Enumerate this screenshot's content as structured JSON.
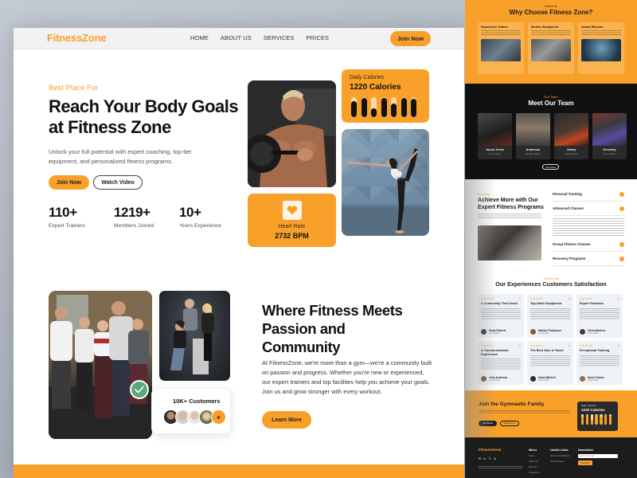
{
  "nav": {
    "logo": "FitnessZone",
    "links": [
      "HOME",
      "ABOUT US",
      "SERVICES",
      "PRICES"
    ],
    "cta": "Join Now"
  },
  "hero": {
    "eyebrow": "Best Place For",
    "title": "Reach Your Body Goals at Fitness Zone",
    "subtitle": "Unlock your full potential with expert coaching, top-tier equipment, and personalized fitness programs.",
    "primary_button": "Join Now",
    "secondary_button": "Watch Video",
    "stats": [
      {
        "value": "110+",
        "label": "Expert Trainers"
      },
      {
        "value": "1219+",
        "label": "Members Joined"
      },
      {
        "value": "10+",
        "label": "Years Experience"
      }
    ],
    "calories_card": {
      "label": "Daily Calories",
      "value": "1220 Calories",
      "bar_fill_levels": [
        0.8,
        0.95,
        0.45,
        0.95,
        0.7,
        0.95,
        0.92
      ]
    },
    "heart_card": {
      "icon": "heart-icon",
      "label": "Heart Rate",
      "value": "2732 BPM"
    }
  },
  "community": {
    "customers_label": "10K+ Customers",
    "more_avatars_symbol": "+",
    "title": "Where Fitness Meets Passion and Community",
    "body": "At FitnessZone, we're more than a gym—we're a community built on passion and progress. Whether you're new or experienced, our expert trainers and top facilities help you achieve your goals. Join us and grow stronger with every workout.",
    "button": "Learn More"
  },
  "preview": {
    "about": {
      "eyebrow": "About us",
      "title": "Why Choose Fitness Zone?",
      "cards": [
        {
          "title": "Experience Trainer"
        },
        {
          "title": "Modern Equipment"
        },
        {
          "title": "Award Winners"
        }
      ]
    },
    "team": {
      "eyebrow": "Our Team",
      "title": "Meet Our Team",
      "members": [
        {
          "name": "Jacob Jones",
          "role": "Gym Trainer"
        },
        {
          "name": "Anderson",
          "role": "Weight Trainer"
        },
        {
          "name": "Jimmy",
          "role": "Yoga Trainer"
        },
        {
          "name": "Kennedy",
          "role": "Gym Trainer"
        }
      ],
      "button": "View More"
    },
    "services": {
      "eyebrow": "Services",
      "title": "Achieve More with Our Expert Fitness Programs",
      "items": [
        "Personal Training",
        "Advanced Classes",
        "Group Fitness Classes",
        "Recovery Programs"
      ]
    },
    "testimonials": {
      "eyebrow": "Testimonial",
      "title": "Our Experiences Customers Satisfaction",
      "stars": "★★★★★",
      "cards": [
        {
          "title": "A Community That Cares!",
          "name": "Emily Roberts",
          "date": "22-09-2024"
        },
        {
          "title": "Top-Notch Equipment",
          "name": "Michael Thompson",
          "date": "21-09-2024"
        },
        {
          "title": "Expert Guidance",
          "name": "Olivia Martinez",
          "date": "21-04-2023"
        },
        {
          "title": "A Transformational Experience!",
          "name": "John Anderson",
          "date": "17-05-2023"
        },
        {
          "title": "The Best Gym in Town!",
          "name": "Sarah Mitchell",
          "date": "16-07-2023"
        },
        {
          "title": "Exceptional Training",
          "name": "David Chavez",
          "date": "12-06-2023"
        }
      ]
    },
    "join": {
      "title": "Join the Gymnastic Family",
      "button_primary": "Get Started",
      "button_secondary": "Watch Demo",
      "calories_label": "Daily Calories",
      "calories_value": "1220 Calories",
      "bar_fill_levels": [
        0.75,
        0.9,
        0.45,
        0.9,
        0.8,
        0.9,
        0.85
      ]
    },
    "footer": {
      "logo": "FitnessZone",
      "menu_title": "Menu",
      "menu_items": [
        "Home",
        "About Us",
        "Services",
        "Contact Us"
      ],
      "links_title": "Useful Links",
      "links_items": [
        "Terms & Conditions",
        "Privacy Policy"
      ],
      "newsletter_title": "Newsletter",
      "newsletter_placeholder": "Enter your email",
      "newsletter_button": "Subscribe"
    }
  },
  "colors": {
    "accent": "#f9a02a",
    "dark": "#111111",
    "check_badge": "#5aa97a"
  }
}
